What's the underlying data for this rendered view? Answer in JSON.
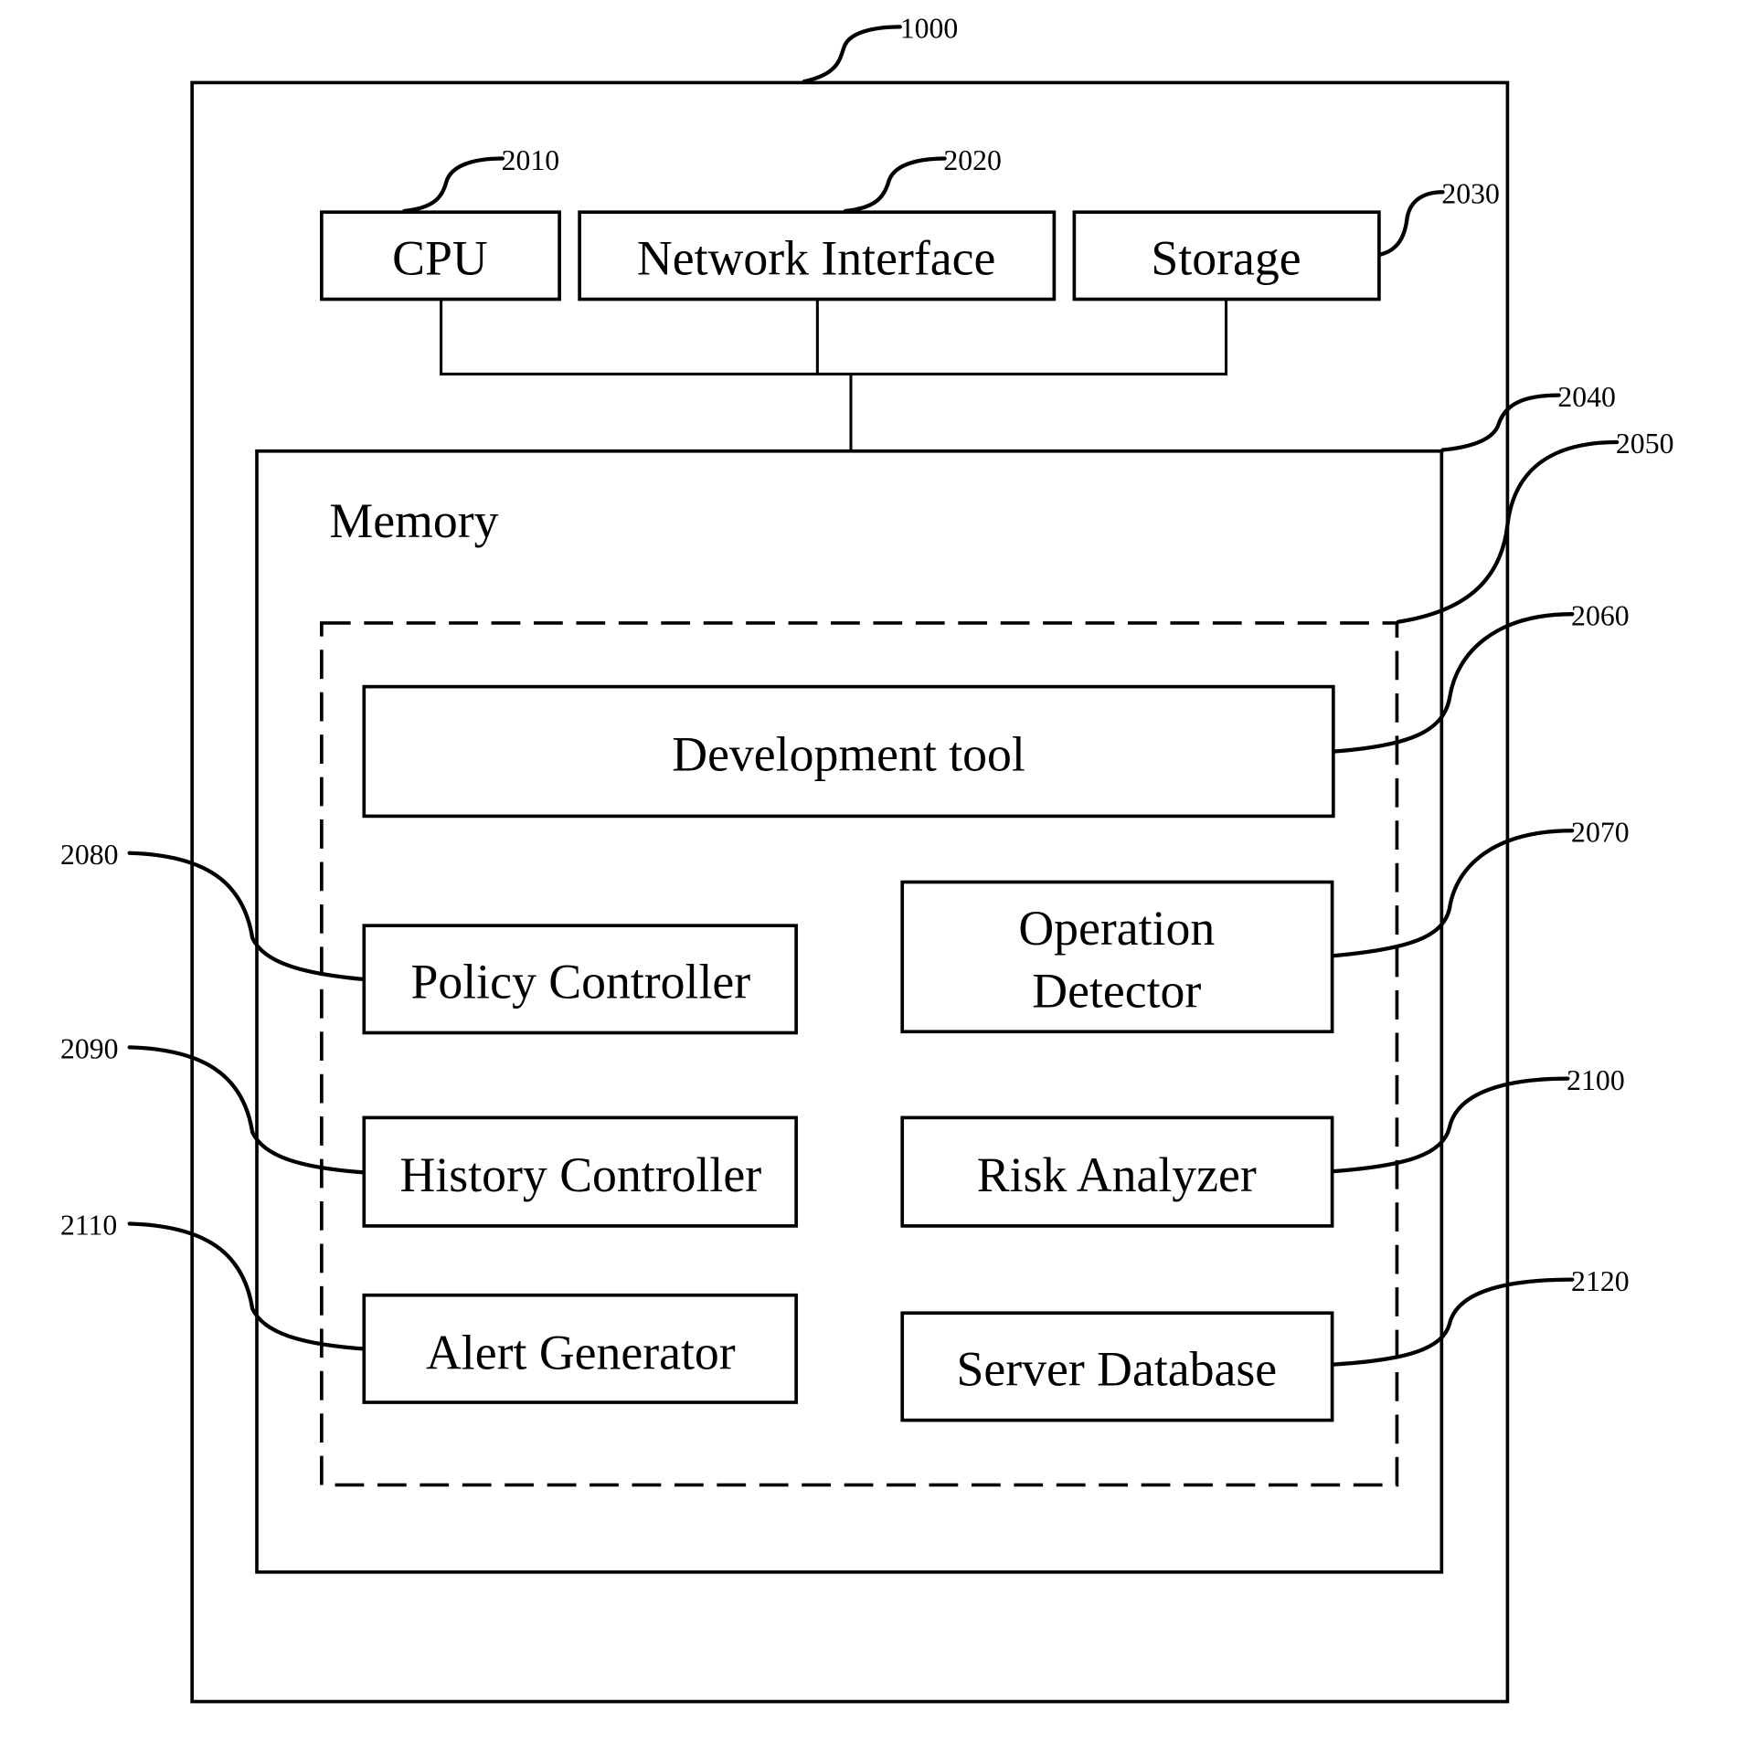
{
  "figure": {
    "system": {
      "ref": "1000"
    },
    "cpu": {
      "label": "CPU",
      "ref": "2010"
    },
    "network_interface": {
      "label": "Network Interface",
      "ref": "2020"
    },
    "storage": {
      "label": "Storage",
      "ref": "2030"
    },
    "memory": {
      "label": "Memory",
      "ref": "2040"
    },
    "module_group": {
      "ref": "2050"
    },
    "development_tool": {
      "label": "Development tool",
      "ref": "2060"
    },
    "operation_detector": {
      "label_line1": "Operation",
      "label_line2": "Detector",
      "ref": "2070"
    },
    "policy_controller": {
      "label": "Policy Controller",
      "ref": "2080"
    },
    "history_controller": {
      "label": "History Controller",
      "ref": "2090"
    },
    "risk_analyzer": {
      "label": "Risk Analyzer",
      "ref": "2100"
    },
    "alert_generator": {
      "label": "Alert Generator",
      "ref": "2110"
    },
    "server_database": {
      "label": "Server Database",
      "ref": "2120"
    }
  }
}
